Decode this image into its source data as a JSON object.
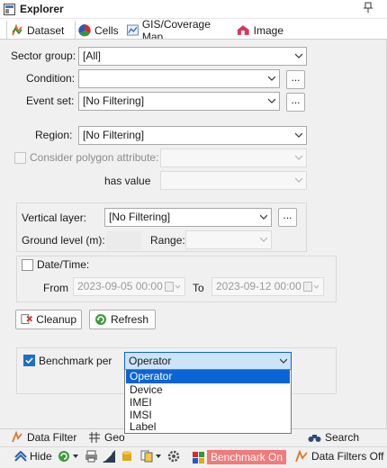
{
  "window": {
    "title": "Explorer",
    "pin_glyph": "†"
  },
  "tabs": [
    {
      "label": "Dataset",
      "icon": "dataset-icon",
      "active": true
    },
    {
      "label": "Cells",
      "icon": "cells-icon",
      "active": false
    },
    {
      "label": "GIS/Coverage Map",
      "icon": "map-icon",
      "active": false
    },
    {
      "label": "Image",
      "icon": "image-icon",
      "active": false
    }
  ],
  "filters": {
    "sector_group": {
      "label": "Sector group:",
      "value": "[All]"
    },
    "condition": {
      "label": "Condition:",
      "value": "",
      "button": "..."
    },
    "event_set": {
      "label": "Event set:",
      "value": "[No Filtering]",
      "button": "..."
    },
    "region": {
      "label": "Region:",
      "value": "[No Filtering]"
    },
    "polygon": {
      "label": "Consider polygon attribute:",
      "checked": false,
      "enabled": false,
      "value": ""
    },
    "has_value": {
      "label": "has value",
      "value": ""
    }
  },
  "vertical": {
    "layer_label": "Vertical layer:",
    "layer_value": "[No Filtering]",
    "button": "...",
    "ground_label": "Ground level (m):",
    "ground_value": "",
    "range_label": "Range:",
    "range_value": ""
  },
  "datetime": {
    "label": "Date/Time:",
    "checked": false,
    "from_label": "From",
    "from_value": "2023-09-05 00:00",
    "to_label": "To",
    "to_value": "2023-09-12 00:00"
  },
  "actions": {
    "cleanup": "Cleanup",
    "refresh": "Refresh"
  },
  "benchmark": {
    "label": "Benchmark per",
    "checked": true,
    "value": "Operator",
    "options": [
      "Operator",
      "Device",
      "IMEI",
      "IMSI",
      "Label"
    ],
    "highlighted": "Operator"
  },
  "bottom_tabs": [
    {
      "label": "Data Filter",
      "icon": "filter-icon"
    },
    {
      "label": "Geo",
      "icon": "grid-icon"
    },
    {
      "label": "Search",
      "icon": "binoculars-icon"
    }
  ],
  "toolbar": {
    "hide": "Hide",
    "benchmark_on": "Benchmark On",
    "data_filters": "Data Filters Off"
  },
  "colors": {
    "accent": "#1f6fc5",
    "selection": "#0a64d6",
    "benchmark_on_bg": "#f27a7a",
    "panel": "#f0f0f0"
  }
}
